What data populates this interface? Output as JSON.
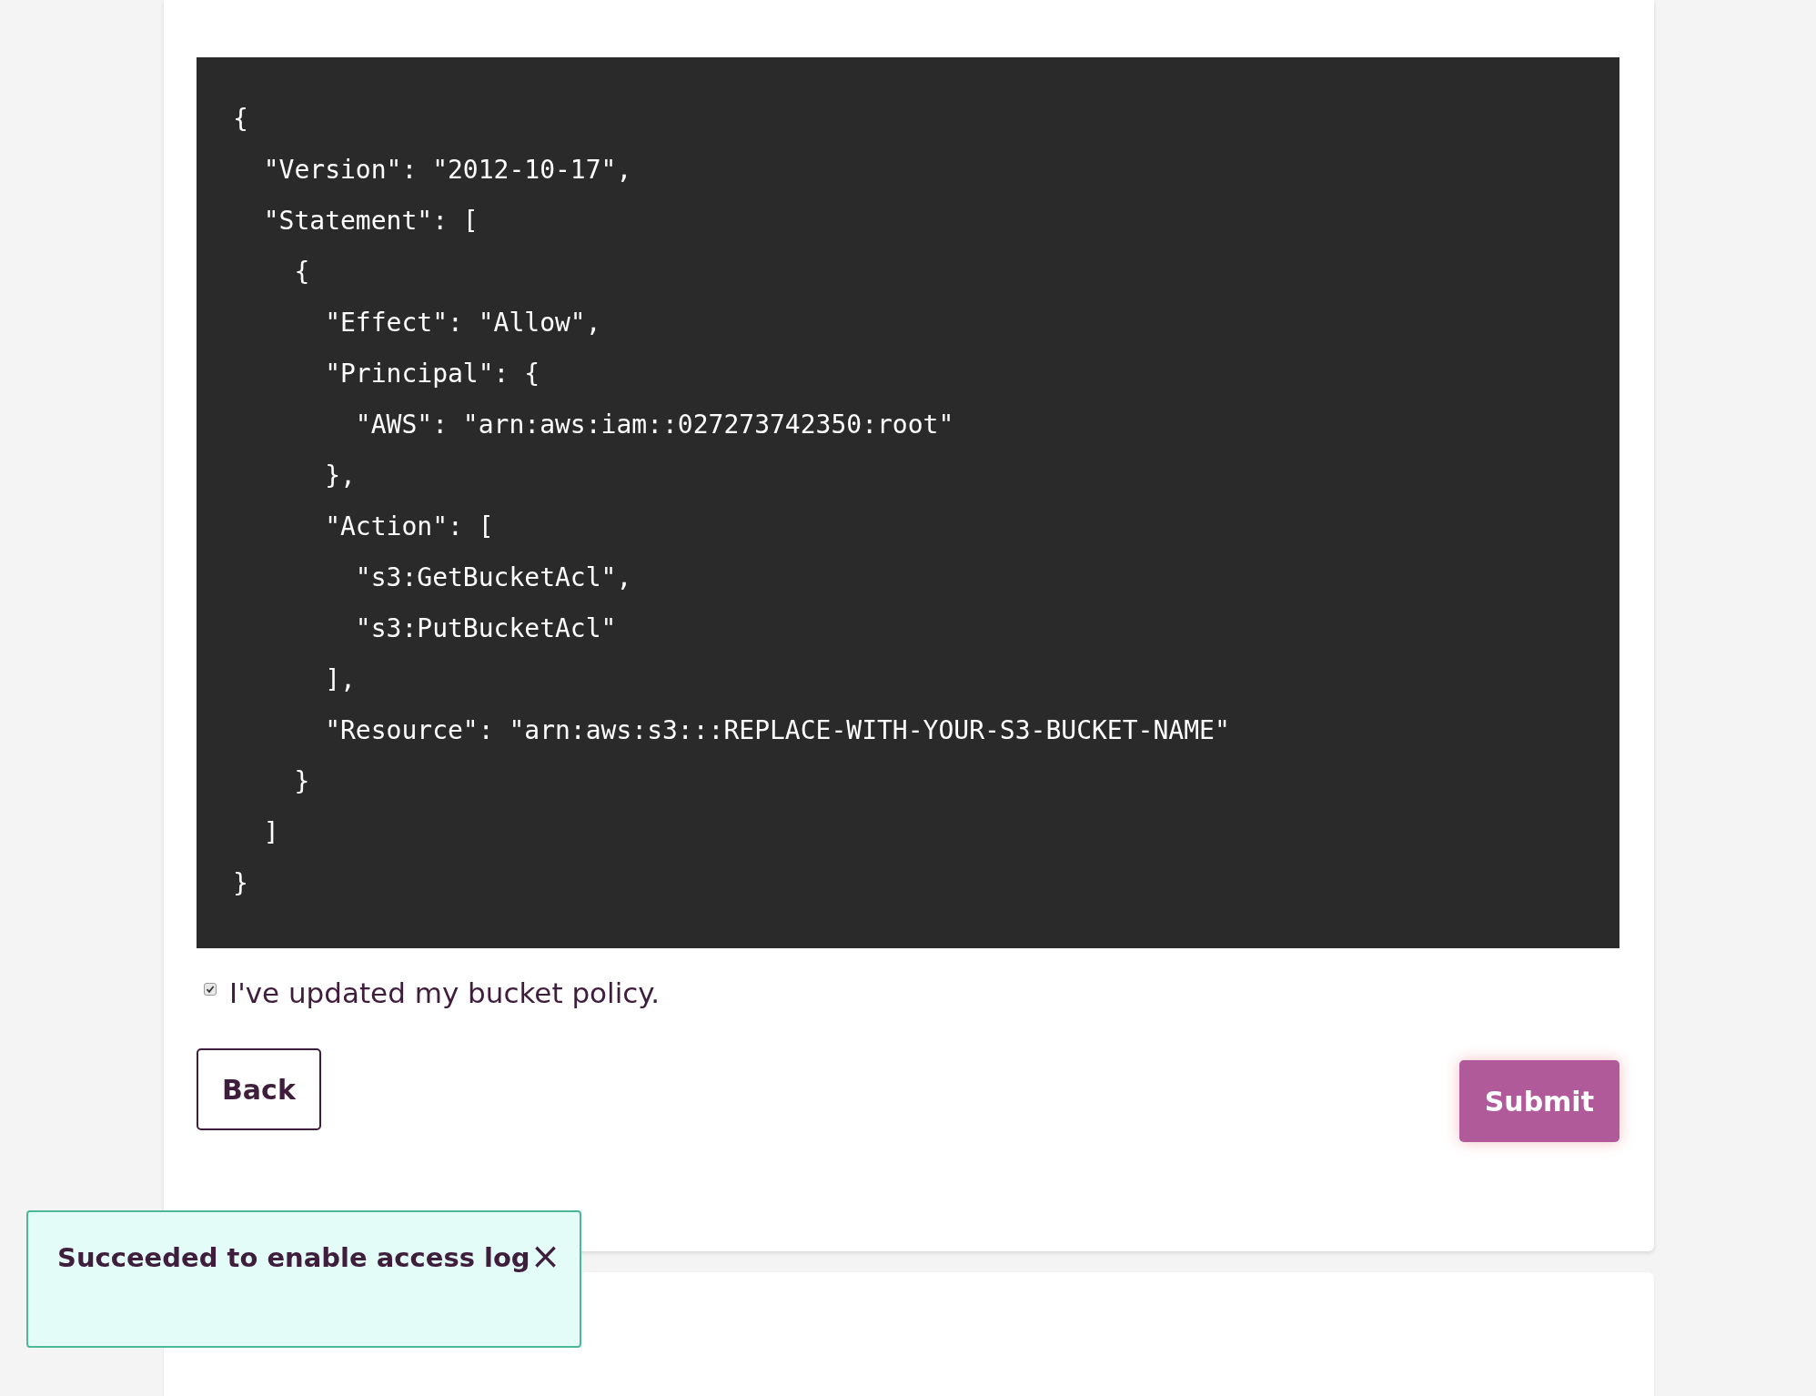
{
  "code_block": {
    "lines": [
      "{",
      "  \"Version\": \"2012-10-17\",",
      "  \"Statement\": [",
      "    {",
      "      \"Effect\": \"Allow\",",
      "      \"Principal\": {",
      "        \"AWS\": \"arn:aws:iam::027273742350:root\"",
      "      },",
      "      \"Action\": [",
      "        \"s3:GetBucketAcl\",",
      "        \"s3:PutBucketAcl\"",
      "      ],",
      "      \"Resource\": \"arn:aws:s3:::REPLACE-WITH-YOUR-S3-BUCKET-NAME\"",
      "    }",
      "  ]",
      "}"
    ]
  },
  "confirm_checkbox": {
    "label": "I've updated my bucket policy.",
    "checked": true
  },
  "buttons": [
    {
      "label": "Back",
      "kind": "secondary"
    },
    {
      "label": "Submit",
      "kind": "primary"
    }
  ],
  "toast": {
    "message": "Succeeded to enable access log",
    "close": "×"
  }
}
